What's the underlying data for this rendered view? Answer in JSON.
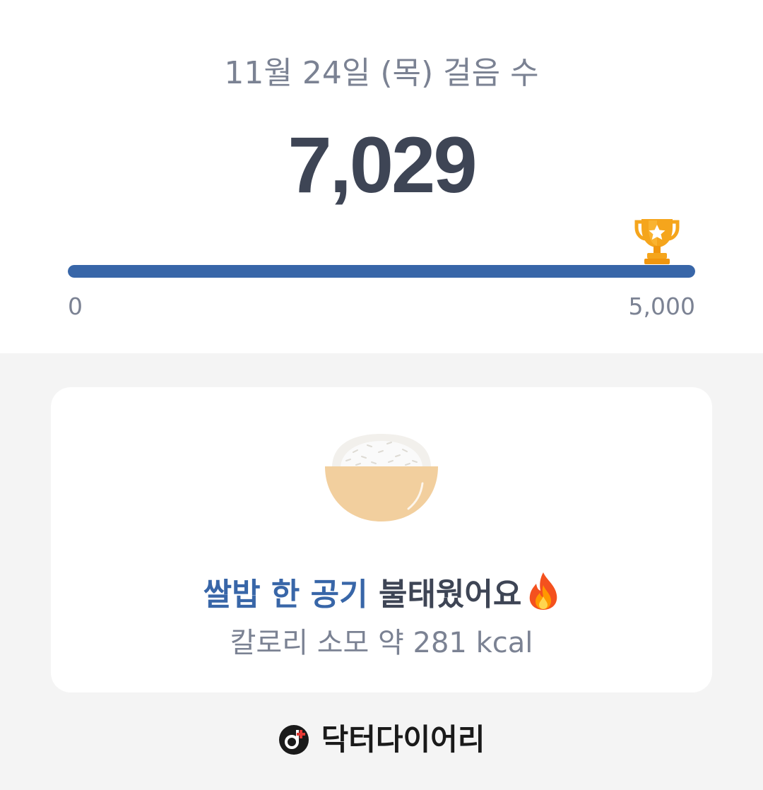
{
  "step_card": {
    "date_title": "11월 24일 (목) 걸음 수",
    "step_count": "7,029",
    "progress": {
      "min_label": "0",
      "max_label": "5,000",
      "current": 7029,
      "goal": 5000,
      "fill_fraction": 1.0,
      "goal_icon": "trophy-icon"
    }
  },
  "calorie_card": {
    "food_icon": "rice-bowl-icon",
    "highlight": "쌀밥 한 공기",
    "message": "불태웠어요",
    "emoji_icon": "fire-icon",
    "detail": "칼로리 소모 약 281 kcal"
  },
  "brand": {
    "logo_icon": "doctor-diary-logo-icon",
    "name": "닥터다이어리"
  },
  "colors": {
    "accent": "#3866a8",
    "text_dark": "#3e4555",
    "text_muted": "#7b8293",
    "background": "#f4f4f4",
    "trophy": "#f5a51c"
  }
}
